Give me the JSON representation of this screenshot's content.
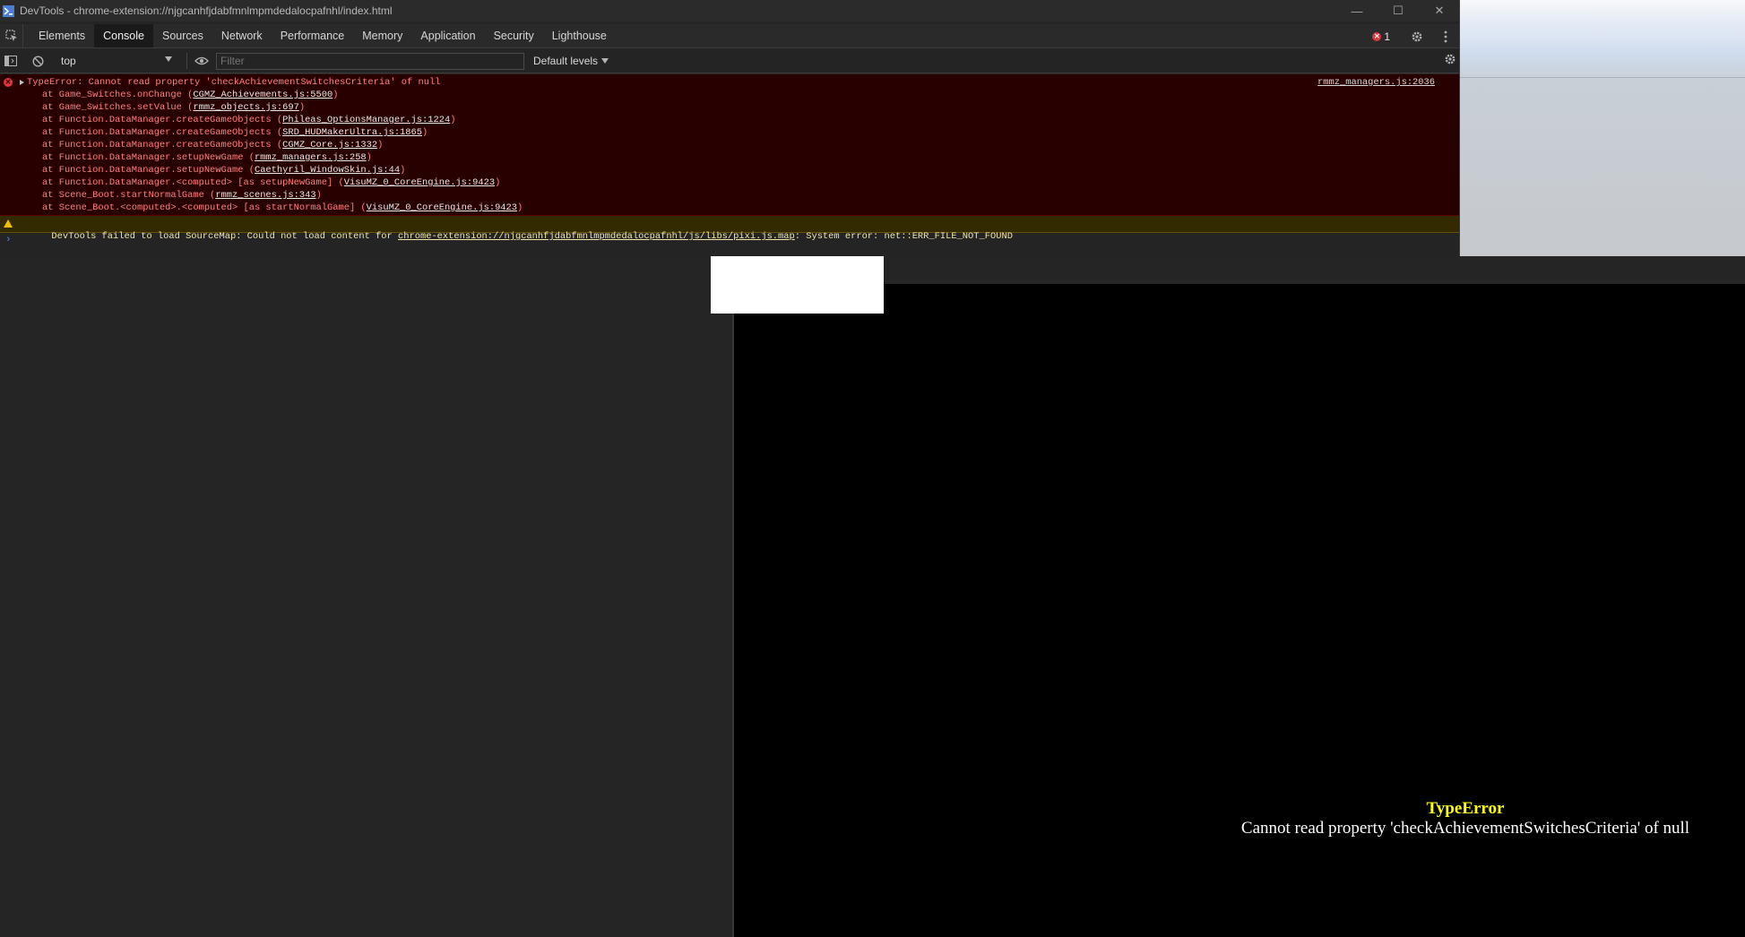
{
  "window": {
    "title": "DevTools - chrome-extension://njgcanhfjdabfmnlmpmdedalocpafnhl/index.html",
    "minimize": "—",
    "maximize": "☐",
    "close": "✕"
  },
  "tabs": [
    {
      "label": "Elements",
      "active": false
    },
    {
      "label": "Console",
      "active": true
    },
    {
      "label": "Sources",
      "active": false
    },
    {
      "label": "Network",
      "active": false
    },
    {
      "label": "Performance",
      "active": false
    },
    {
      "label": "Memory",
      "active": false
    },
    {
      "label": "Application",
      "active": false
    },
    {
      "label": "Security",
      "active": false
    },
    {
      "label": "Lighthouse",
      "active": false
    }
  ],
  "error_count": "1",
  "toolbar": {
    "context": "top",
    "filter_placeholder": "Filter",
    "levels": "Default levels"
  },
  "error": {
    "message": "TypeError: Cannot read property 'checkAchievementSwitchesCriteria' of null",
    "source": "rmmz_managers.js:2036",
    "stack": [
      {
        "prefix": "at Game_Switches.onChange (",
        "link": "CGMZ_Achievements.js:5500",
        "suffix": ")"
      },
      {
        "prefix": "at Game_Switches.setValue (",
        "link": "rmmz_objects.js:697",
        "suffix": ")"
      },
      {
        "prefix": "at Function.DataManager.createGameObjects (",
        "link": "Phileas_OptionsManager.js:1224",
        "suffix": ")"
      },
      {
        "prefix": "at Function.DataManager.createGameObjects (",
        "link": "SRD_HUDMakerUltra.js:1865",
        "suffix": ")"
      },
      {
        "prefix": "at Function.DataManager.createGameObjects (",
        "link": "CGMZ_Core.js:1332",
        "suffix": ")"
      },
      {
        "prefix": "at Function.DataManager.setupNewGame (",
        "link": "rmmz_managers.js:258",
        "suffix": ")"
      },
      {
        "prefix": "at Function.DataManager.setupNewGame (",
        "link": "Caethyril_WindowSkin.js:44",
        "suffix": ")"
      },
      {
        "prefix": "at Function.DataManager.<computed> [as setupNewGame] (",
        "link": "VisuMZ_0_CoreEngine.js:9423",
        "suffix": ")"
      },
      {
        "prefix": "at Scene_Boot.startNormalGame (",
        "link": "rmmz_scenes.js:343",
        "suffix": ")"
      },
      {
        "prefix": "at Scene_Boot.<computed>.<computed> [as startNormalGame] (",
        "link": "VisuMZ_0_CoreEngine.js:9423",
        "suffix": ")"
      }
    ]
  },
  "warning": {
    "prefix": "DevTools failed to load SourceMap: Could not load content for ",
    "link": "chrome-extension://njgcanhfjdabfmnlmpmdedalocpafnhl/js/libs/pixi.js.map",
    "suffix": ": System error: net::ERR_FILE_NOT_FOUND"
  },
  "prompt": "›",
  "game": {
    "error_title": "TypeError",
    "error_message": "Cannot read property 'checkAchievementSwitchesCriteria' of null"
  }
}
